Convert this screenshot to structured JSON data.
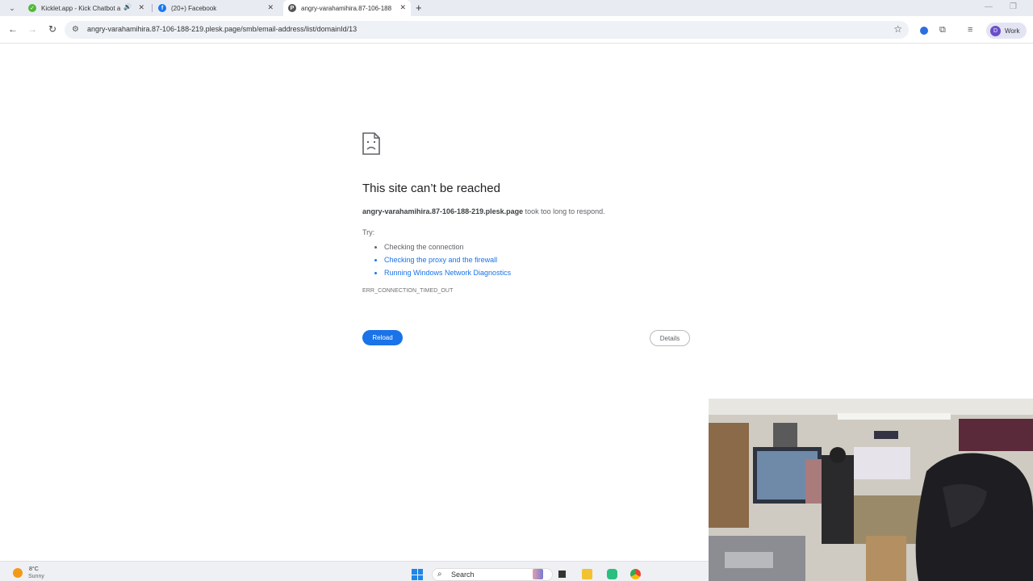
{
  "tabs": [
    {
      "title": "Kicklet.app - Kick Chatbot a",
      "favicon": "kicklet-icon",
      "color": "#53b83a",
      "audio": true
    },
    {
      "title": "(20+) Facebook",
      "favicon": "facebook-icon",
      "color": "#1877f2",
      "audio": false
    },
    {
      "title": "angry-varahamihira.87-106-188",
      "favicon": "plesk-icon",
      "color": "#555555",
      "audio": false,
      "active": true
    }
  ],
  "toolbar": {
    "url": "angry-varahamihira.87-106-188-219.plesk.page/smb/email-address/list/domainId/13",
    "profile_initial": "D",
    "profile_label": "Work"
  },
  "error": {
    "title": "This site can’t be reached",
    "host": "angry-varahamihira.87-106-188-219.plesk.page",
    "message": " took too long to respond.",
    "try_label": "Try:",
    "suggestions": [
      {
        "text": "Checking the connection",
        "link": false
      },
      {
        "text": "Checking the proxy and the firewall",
        "link": true
      },
      {
        "text": "Running Windows Network Diagnostics",
        "link": true
      }
    ],
    "code": "ERR_CONNECTION_TIMED_OUT",
    "reload_label": "Reload",
    "details_label": "Details"
  },
  "taskbar": {
    "temperature": "8°C",
    "condition": "Sunny",
    "search_placeholder": "Search"
  },
  "colors": {
    "accent": "#1a73e8",
    "tabstrip": "#e8ecf2"
  }
}
